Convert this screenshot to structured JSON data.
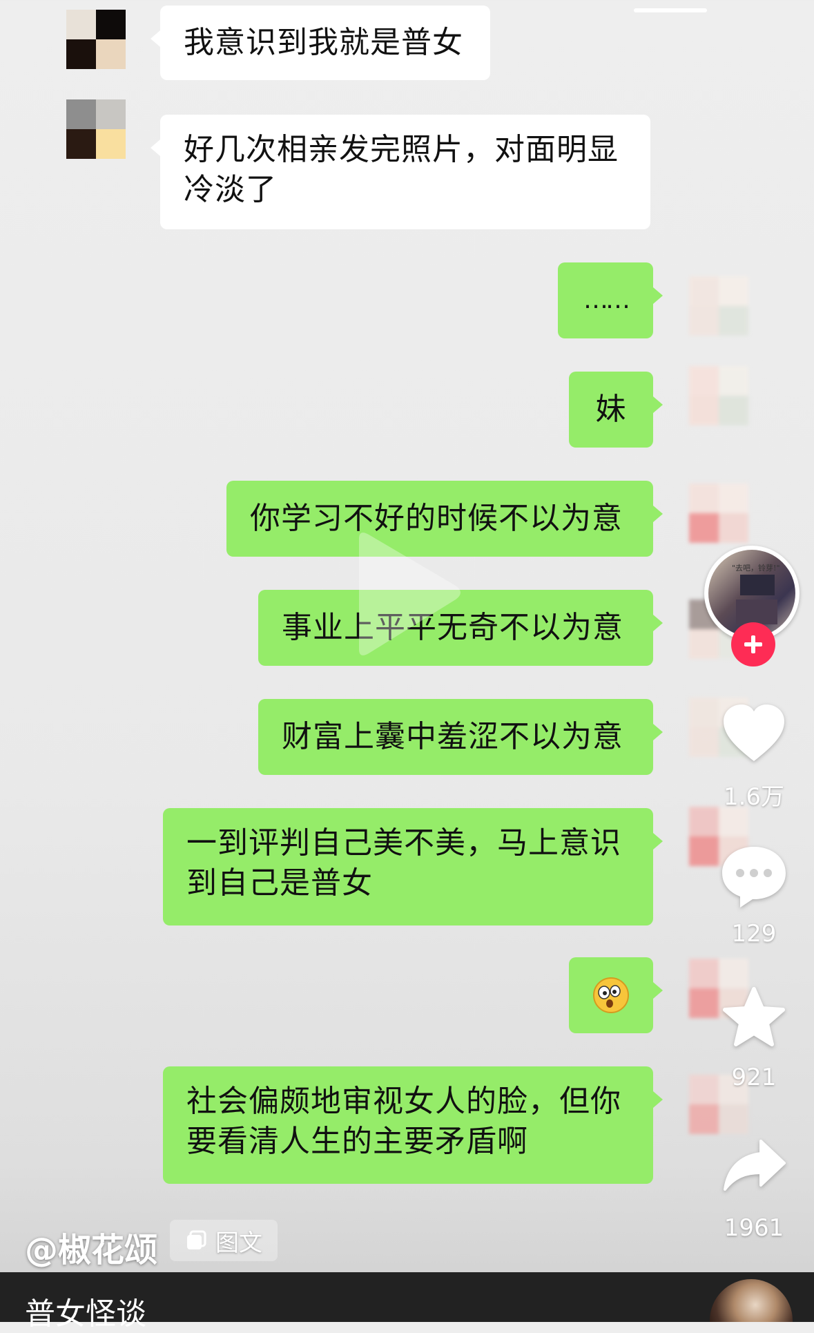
{
  "messages": [
    {
      "side": "left",
      "text": "我意识到我就是普女"
    },
    {
      "side": "left",
      "text": "好几次相亲发完照片，对面明显\n冷淡了"
    },
    {
      "side": "right",
      "text": "……"
    },
    {
      "side": "right",
      "text": "妹"
    },
    {
      "side": "right",
      "text": "你学习不好的时候不以为意"
    },
    {
      "side": "right",
      "text": "事业上平平无奇不以为意"
    },
    {
      "side": "right",
      "text": "财富上囊中羞涩不以为意"
    },
    {
      "side": "right",
      "text": "一到评判自己美不美，马上意识\n到自己是普女"
    },
    {
      "side": "right",
      "text": "",
      "emoji": "surprised-face-emoji"
    },
    {
      "side": "right",
      "text": "社会偏颇地审视女人的脸，但你\n要看清人生的主要矛盾啊"
    }
  ],
  "sidebar": {
    "likes": "1.6万",
    "comments": "129",
    "favorites": "921",
    "shares": "1961",
    "follow_icon": "plus-icon",
    "creator_card_text": "\"去吧，铃芽!\""
  },
  "footer": {
    "author": "@椒花颂",
    "tag_label": "图文",
    "title": "普女怪谈"
  },
  "colors": {
    "green_bubble": "#95ec69",
    "white_bubble": "#ffffff",
    "follow_red": "#fe2c55"
  }
}
